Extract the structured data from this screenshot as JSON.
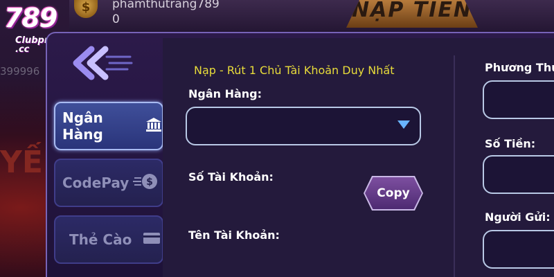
{
  "header": {
    "player_name": "phamthutrang789",
    "player_balance": "0",
    "coin_symbol": "$",
    "banner_title": "NẠP TIỀN",
    "side_balance": "399996",
    "side_decoration": "YẾN N ẠI"
  },
  "logo": {
    "number": "789",
    "sub": "Clubpro .cc"
  },
  "tabs": [
    {
      "label": "Ngân Hàng",
      "icon": "bank-icon",
      "active": true
    },
    {
      "label": "CodePay",
      "icon": "dollar-coin-icon",
      "active": false
    },
    {
      "label": "Thẻ Cào",
      "icon": "card-icon",
      "active": false
    }
  ],
  "form": {
    "notice": "Nạp - Rút 1 Chủ Tài Khoản Duy Nhất",
    "bank_label": "Ngân Hàng:",
    "bank_value": "",
    "account_number_label": "Số Tài Khoản:",
    "copy_button": "Copy",
    "account_name_label": "Tên Tài Khoản:"
  },
  "right_form": {
    "method_label": "Phương Thức",
    "amount_label": "Số Tiền:",
    "sender_label": "Người Gửi:"
  },
  "colors": {
    "notice": "#e8dc3a",
    "active_tab": "#3f4f9a",
    "panel": "#241a3c",
    "select_arrow": "#69b4ff"
  }
}
